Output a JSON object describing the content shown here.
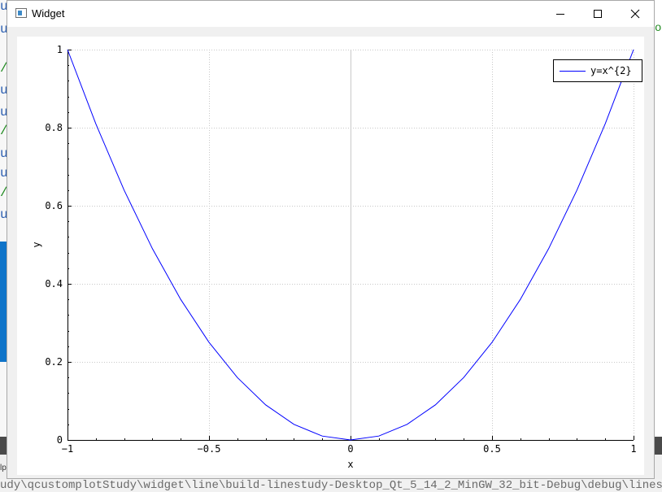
{
  "window": {
    "title": "Widget",
    "icon": "window-app-icon",
    "controls": [
      "minimize-icon",
      "maximize-icon",
      "close-icon"
    ]
  },
  "background": {
    "left_chars": [
      "u",
      "u",
      "/",
      "u",
      "u",
      "/",
      "u",
      "u",
      "/",
      "u"
    ],
    "right_char": "o",
    "left_tag": "lp",
    "bottom_path": "udy\\qcustomplotStudy\\widget\\line\\build-linestudy-Desktop_Qt_5_14_2_MinGW_32_bit-Debug\\debug\\linestudy.exe"
  },
  "colors": {
    "curve": "#0000ff",
    "grid": "#c8c8c8",
    "zero_line": "#c8c8c8",
    "axis": "#000000"
  },
  "chart_data": {
    "type": "line",
    "title": "",
    "xlabel": "x",
    "ylabel": "y",
    "xlim": [
      -1,
      1
    ],
    "ylim": [
      0,
      1
    ],
    "x_ticks": [
      -1,
      -0.5,
      0,
      0.5,
      1
    ],
    "x_tick_labels": [
      "−1",
      "−0.5",
      "0",
      "0.5",
      "1"
    ],
    "y_ticks": [
      0,
      0.2,
      0.4,
      0.6,
      0.8,
      1
    ],
    "y_tick_labels": [
      "0",
      "0.2",
      "0.4",
      "0.6",
      "0.8",
      "1"
    ],
    "grid": true,
    "grid_style": "dotted",
    "legend": {
      "position": "top-right"
    },
    "series": [
      {
        "name": "y=x^{2}",
        "color": "#0000ff",
        "x": [
          -1,
          -0.9,
          -0.8,
          -0.7,
          -0.6,
          -0.5,
          -0.4,
          -0.3,
          -0.2,
          -0.1,
          0,
          0.1,
          0.2,
          0.3,
          0.4,
          0.5,
          0.6,
          0.7,
          0.8,
          0.9,
          1
        ],
        "y": [
          1,
          0.81,
          0.64,
          0.49,
          0.36,
          0.25,
          0.16,
          0.09,
          0.04,
          0.01,
          0,
          0.01,
          0.04,
          0.09,
          0.16,
          0.25,
          0.36,
          0.49,
          0.64,
          0.81,
          1
        ]
      }
    ]
  }
}
